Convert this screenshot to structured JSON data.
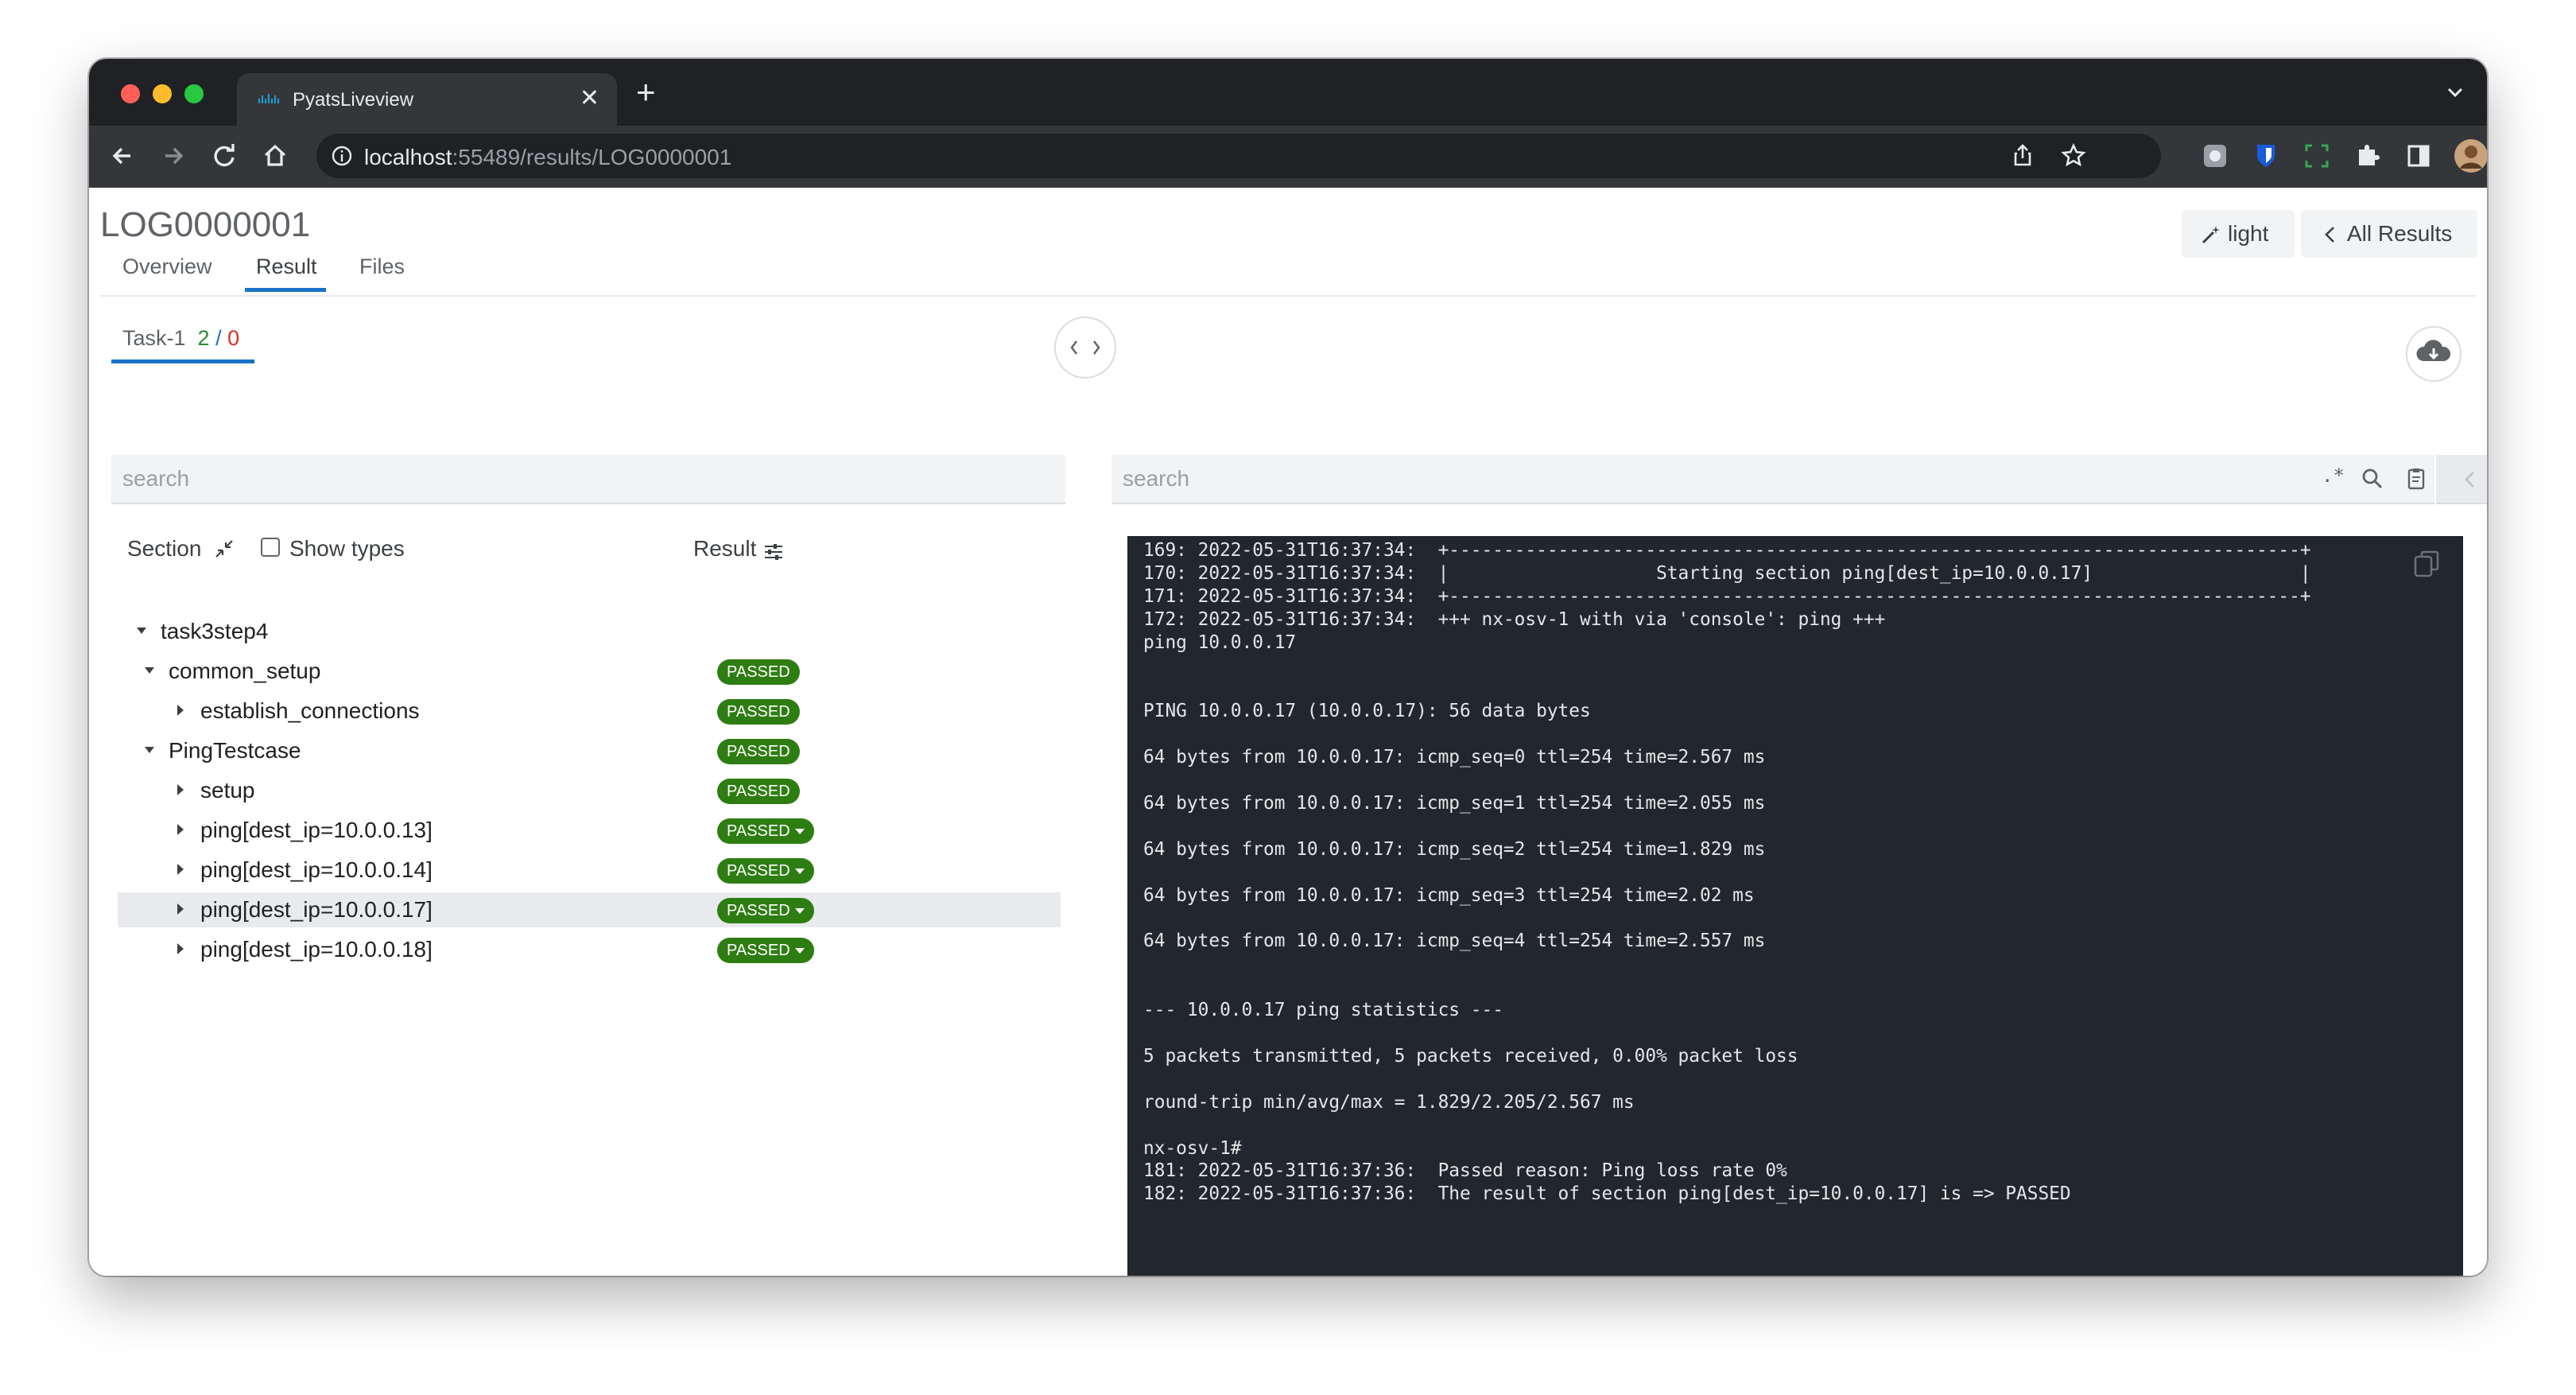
{
  "browser": {
    "tab_title": "PyatsLiveview",
    "tab_close": "✕",
    "new_tab": "+",
    "url_host": "localhost",
    "url_rest": ":55489/results/LOG0000001"
  },
  "header": {
    "title": "LOG0000001",
    "tabs": [
      {
        "label": "Overview"
      },
      {
        "label": "Result"
      },
      {
        "label": "Files"
      }
    ],
    "theme_button": "light",
    "all_results_button": "All Results"
  },
  "task": {
    "label": "Task-1",
    "passed": "2",
    "separator": "/",
    "failed": "0"
  },
  "left_panel": {
    "search_placeholder": "search",
    "section_header": "Section",
    "show_types_label": "Show types",
    "result_header": "Result"
  },
  "tree": [
    {
      "label": "task3step4",
      "result": ""
    },
    {
      "label": "common_setup",
      "result": "PASSED"
    },
    {
      "label": "establish_connections",
      "result": "PASSED"
    },
    {
      "label": "PingTestcase",
      "result": "PASSED"
    },
    {
      "label": "setup",
      "result": "PASSED"
    },
    {
      "label": "ping[dest_ip=10.0.0.13]",
      "result": "PASSED"
    },
    {
      "label": "ping[dest_ip=10.0.0.14]",
      "result": "PASSED"
    },
    {
      "label": "ping[dest_ip=10.0.0.17]",
      "result": "PASSED"
    },
    {
      "label": "ping[dest_ip=10.0.0.18]",
      "result": "PASSED"
    }
  ],
  "right_panel": {
    "search_placeholder": "search",
    "regex_toggle": ".*"
  },
  "log_lines": [
    "169: 2022-05-31T16:37:34:  +------------------------------------------------------------------------------+",
    "170: 2022-05-31T16:37:34:  |                   Starting section ping[dest_ip=10.0.0.17]                   |",
    "171: 2022-05-31T16:37:34:  +------------------------------------------------------------------------------+",
    "172: 2022-05-31T16:37:34:  +++ nx-osv-1 with via 'console': ping +++",
    "ping 10.0.0.17",
    "",
    "",
    "PING 10.0.0.17 (10.0.0.17): 56 data bytes",
    "",
    "64 bytes from 10.0.0.17: icmp_seq=0 ttl=254 time=2.567 ms",
    "",
    "64 bytes from 10.0.0.17: icmp_seq=1 ttl=254 time=2.055 ms",
    "",
    "64 bytes from 10.0.0.17: icmp_seq=2 ttl=254 time=1.829 ms",
    "",
    "64 bytes from 10.0.0.17: icmp_seq=3 ttl=254 time=2.02 ms",
    "",
    "64 bytes from 10.0.0.17: icmp_seq=4 ttl=254 time=2.557 ms",
    "",
    "",
    "--- 10.0.0.17 ping statistics ---",
    "",
    "5 packets transmitted, 5 packets received, 0.00% packet loss",
    "",
    "round-trip min/avg/max = 1.829/2.205/2.567 ms",
    "",
    "nx-osv-1#",
    "181: 2022-05-31T16:37:36:  Passed reason: Ping loss rate 0%",
    "182: 2022-05-31T16:37:36:  The result of section ping[dest_ip=10.0.0.17] is => PASSED"
  ],
  "colors": {
    "passed_badge": "#2e7d12",
    "accent": "#1a73c8",
    "terminal_bg": "#22272e",
    "failed": "#d93025"
  }
}
